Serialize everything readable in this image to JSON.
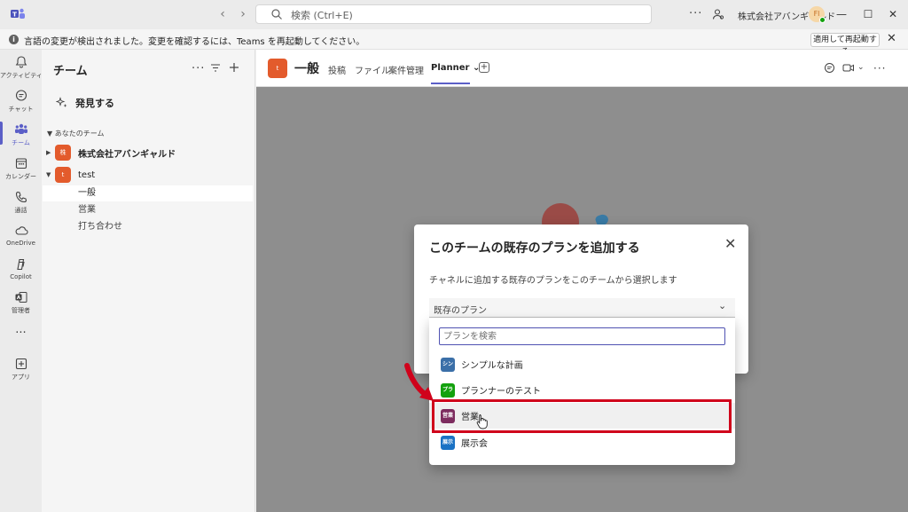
{
  "titlebar": {
    "search_placeholder": "検索 (Ctrl+E)",
    "more_label": "···",
    "org_name": "株式会社アバンギャルド",
    "avatar_initials": "Fl",
    "minimize": "—",
    "maximize": "☐",
    "close": "✕"
  },
  "notification": {
    "text": "言語の変更が検出されました。変更を確認するには、Teams を再起動してください。",
    "restart_button": "適用して再起動する",
    "close": "✕"
  },
  "rail": {
    "items": [
      {
        "label": "アクティビティ",
        "icon": "bell-icon"
      },
      {
        "label": "チャット",
        "icon": "chat-icon"
      },
      {
        "label": "チーム",
        "icon": "teams-icon"
      },
      {
        "label": "カレンダー",
        "icon": "calendar-icon"
      },
      {
        "label": "通話",
        "icon": "phone-icon"
      },
      {
        "label": "OneDrive",
        "icon": "cloud-icon"
      },
      {
        "label": "Copilot",
        "icon": "copilot-icon"
      },
      {
        "label": "管理者",
        "icon": "admin-icon"
      },
      {
        "label": "アプリ",
        "icon": "add-app-icon"
      }
    ],
    "more_label": "···"
  },
  "team_panel": {
    "title": "チーム",
    "discover": "発見する",
    "section_label": "あなたのチーム",
    "teams": [
      {
        "name": "株式会社アバンギャルド",
        "initial": "株",
        "caret": "▶"
      },
      {
        "name": "test",
        "initial": "t",
        "caret": "▼"
      }
    ],
    "channels": [
      "一般",
      "営業",
      "打ち合わせ"
    ]
  },
  "main_header": {
    "channel_initial": "t",
    "channel_title": "一般",
    "tabs": [
      "投稿",
      "ファイル",
      "案件管理",
      "Planner"
    ],
    "planner_chevron": "⌄",
    "more": "···"
  },
  "dialog": {
    "title": "このチームの既存のプランを追加する",
    "description": "チャネルに追加する既存のプランをこのチームから選択します",
    "select_label": "既存のプラン",
    "close": "✕",
    "chevron": "⌄",
    "search_placeholder": "プランを検索",
    "plans": [
      {
        "badge": "シン",
        "name": "シンプルな計画",
        "color": "#3b6fa8"
      },
      {
        "badge": "プラ",
        "name": "プランナーのテスト",
        "color": "#13a10e"
      },
      {
        "badge": "営業",
        "name": "営業",
        "color": "#7d2c5f"
      },
      {
        "badge": "展示",
        "name": "展示会",
        "color": "#1a72c4"
      }
    ]
  },
  "colors": {
    "accent": "#5b5fc7",
    "highlight": "#d0021b",
    "team_avatar": "#e35b2c"
  }
}
